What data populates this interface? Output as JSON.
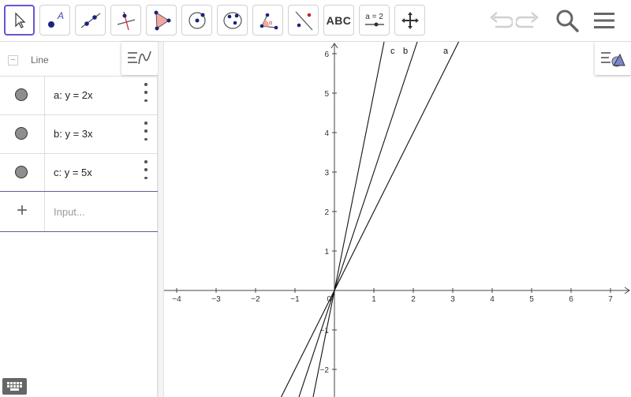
{
  "toolbar": {
    "text_tool_label": "ABC",
    "slider_tool_label": "a = 2"
  },
  "algebra": {
    "group_label": "Line",
    "rows": [
      {
        "expr": "a: y = 2x"
      },
      {
        "expr": "b: y = 3x"
      },
      {
        "expr": "c: y = 5x"
      }
    ],
    "input_placeholder": "Input..."
  },
  "graph": {
    "x_ticks": [
      "−4",
      "−3",
      "−2",
      "−1",
      "0",
      "1",
      "2",
      "3",
      "4",
      "5",
      "6",
      "7"
    ],
    "y_ticks_pos": [
      "1",
      "2",
      "3",
      "4",
      "5",
      "6"
    ],
    "y_ticks_neg": [
      "−1",
      "−2"
    ],
    "line_labels": [
      "c",
      "b",
      "a"
    ],
    "lines": [
      {
        "name": "a",
        "slope": 2
      },
      {
        "name": "b",
        "slope": 3
      },
      {
        "name": "c",
        "slope": 5
      }
    ]
  },
  "colors": {
    "active_tool_border": "#6557d2",
    "marble": "#8e8e8e",
    "input_border": "#6d5b97"
  }
}
